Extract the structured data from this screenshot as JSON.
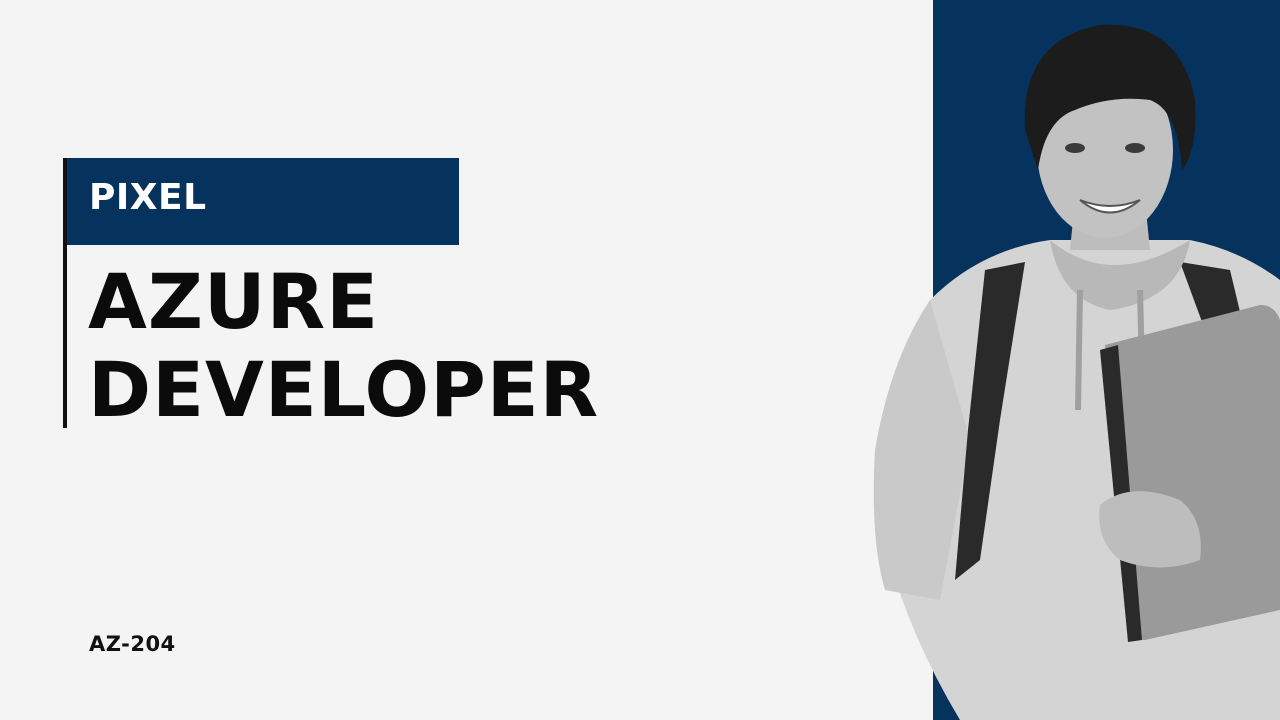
{
  "brand": {
    "label": "PIXEL"
  },
  "headline": {
    "line1": "AZURE",
    "line2": "DEVELOPER"
  },
  "exam_code": "AZ-204",
  "colors": {
    "accent_navy": "#05335e",
    "background": "#f4f4f4",
    "text": "#0b0b0b"
  },
  "image": {
    "subject": "smiling student with backpack holding laptop (grayscale)"
  }
}
